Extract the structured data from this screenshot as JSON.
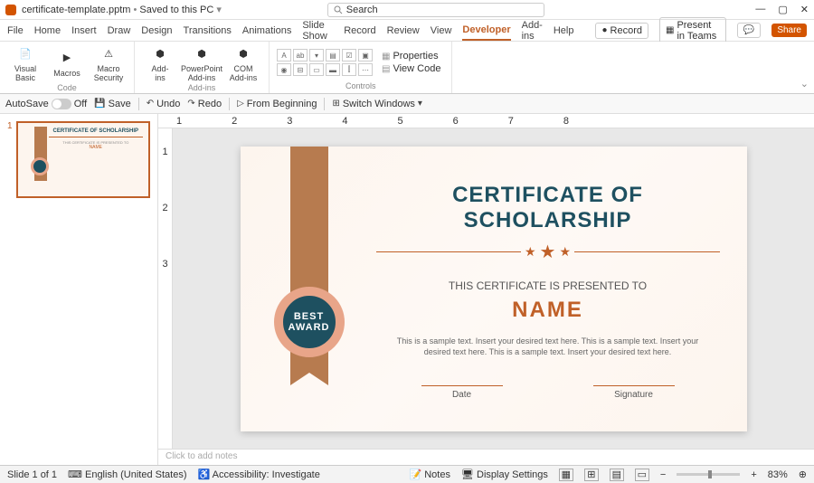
{
  "titlebar": {
    "filename": "certificate-template.pptm",
    "status": "Saved to this PC",
    "search_placeholder": "Search"
  },
  "tabs": {
    "file": "File",
    "home": "Home",
    "insert": "Insert",
    "draw": "Draw",
    "design": "Design",
    "transitions": "Transitions",
    "animations": "Animations",
    "slideshow": "Slide Show",
    "record": "Record",
    "review": "Review",
    "view": "View",
    "developer": "Developer",
    "addins": "Add-ins",
    "help": "Help",
    "record_btn": "Record",
    "present_btn": "Present in Teams",
    "share_btn": "Share"
  },
  "ribbon": {
    "code": {
      "vb": "Visual\nBasic",
      "macros": "Macros",
      "security": "Macro\nSecurity",
      "label": "Code"
    },
    "addins": {
      "addins": "Add-\nins",
      "ppt": "PowerPoint\nAdd-ins",
      "com": "COM\nAdd-ins",
      "label": "Add-ins"
    },
    "controls": {
      "properties": "Properties",
      "viewcode": "View Code",
      "label": "Controls"
    }
  },
  "qat": {
    "autosave": "AutoSave",
    "off": "Off",
    "save": "Save",
    "undo": "Undo",
    "redo": "Redo",
    "beginning": "From Beginning",
    "switch": "Switch Windows"
  },
  "thumb": {
    "num": "1",
    "title": "CERTIFICATE OF SCHOLARSHIP",
    "name": "NAME"
  },
  "slide": {
    "title": "CERTIFICATE OF SCHOLARSHIP",
    "subtitle": "THIS CERTIFICATE IS PRESENTED TO",
    "name": "NAME",
    "body": "This is a sample text. Insert your desired text here. This is a sample text. Insert your desired text here. This is a sample text. Insert your desired text here.",
    "date": "Date",
    "signature": "Signature",
    "seal1": "BEST",
    "seal2": "AWARD"
  },
  "notes": {
    "placeholder": "Click to add notes"
  },
  "status": {
    "slide": "Slide 1 of 1",
    "lang": "English (United States)",
    "access": "Accessibility: Investigate",
    "notes": "Notes",
    "display": "Display Settings",
    "zoom": "83%",
    "minus": "−",
    "plus": "+"
  }
}
